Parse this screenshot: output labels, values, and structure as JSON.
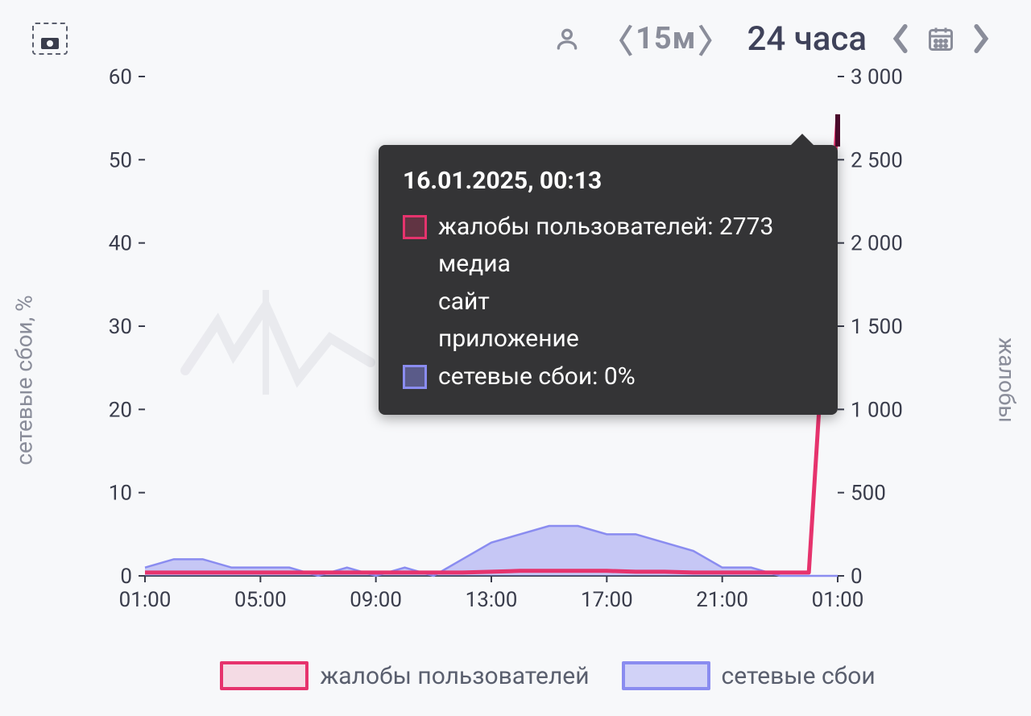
{
  "toolbar": {
    "range_15m": "15м",
    "range_24h": "24 часа"
  },
  "axes": {
    "left_title": "сетевые сбои, %",
    "right_title": "жалобы",
    "left_ticks": [
      "0",
      "10",
      "20",
      "30",
      "40",
      "50",
      "60"
    ],
    "right_ticks": [
      "0",
      "500",
      "1 000",
      "1 500",
      "2 000",
      "2 500",
      "3 000"
    ],
    "x_ticks": [
      "01:00",
      "05:00",
      "09:00",
      "13:00",
      "17:00",
      "21:00",
      "01:00"
    ]
  },
  "legend": {
    "complaints": "жалобы пользователей",
    "failures": "сетевые сбои"
  },
  "tooltip": {
    "timestamp": "16.01.2025, 00:13",
    "line1_full": "жалобы пользователей: 2773",
    "sub1": "медиа",
    "sub2": "сайт",
    "sub3": "приложение",
    "line2_full": "сетевые сбои: 0%"
  },
  "chart_data": {
    "type": "line",
    "xlabel": "",
    "ylabel_left": "сетевые сбои, %",
    "ylabel_right": "жалобы",
    "ylim_left": [
      0,
      60
    ],
    "ylim_right": [
      0,
      3000
    ],
    "x": [
      "01:00",
      "02:00",
      "03:00",
      "04:00",
      "05:00",
      "06:00",
      "07:00",
      "08:00",
      "09:00",
      "10:00",
      "11:00",
      "12:00",
      "13:00",
      "14:00",
      "15:00",
      "16:00",
      "17:00",
      "18:00",
      "19:00",
      "20:00",
      "21:00",
      "22:00",
      "23:00",
      "00:00",
      "00:13"
    ],
    "series": [
      {
        "name": "жалобы пользователей",
        "axis": "right",
        "color": "#e6336d",
        "values": [
          20,
          20,
          20,
          20,
          20,
          20,
          20,
          20,
          20,
          20,
          20,
          20,
          25,
          30,
          30,
          30,
          30,
          25,
          25,
          20,
          20,
          20,
          20,
          20,
          2773
        ]
      },
      {
        "name": "сетевые сбои",
        "axis": "left",
        "color": "#8a8cf0",
        "values": [
          1,
          2,
          2,
          1,
          1,
          1,
          0,
          1,
          0,
          1,
          0,
          2,
          4,
          5,
          6,
          6,
          5,
          5,
          4,
          3,
          1,
          1,
          0,
          0,
          0
        ]
      }
    ],
    "highlight": {
      "x": "00:13",
      "жалобы пользователей": 2773,
      "сетевые сбои": 0,
      "breakdown": [
        "медиа",
        "сайт",
        "приложение"
      ]
    }
  }
}
